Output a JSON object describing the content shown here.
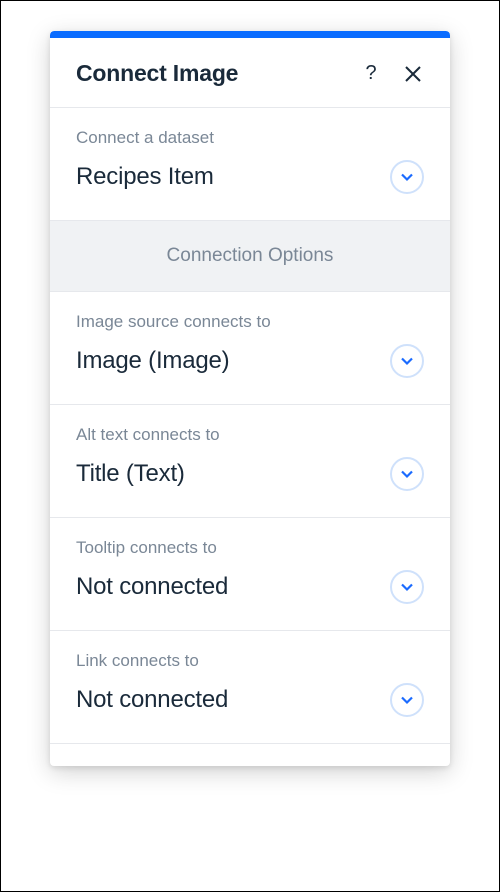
{
  "header": {
    "title": "Connect Image"
  },
  "dataset": {
    "label": "Connect a dataset",
    "value": "Recipes Item"
  },
  "optionsHeader": "Connection Options",
  "fields": [
    {
      "label": "Image source connects to",
      "value": "Image (Image)"
    },
    {
      "label": "Alt text connects to",
      "value": "Title (Text)"
    },
    {
      "label": "Tooltip connects to",
      "value": "Not connected"
    },
    {
      "label": "Link connects to",
      "value": "Not connected"
    }
  ]
}
